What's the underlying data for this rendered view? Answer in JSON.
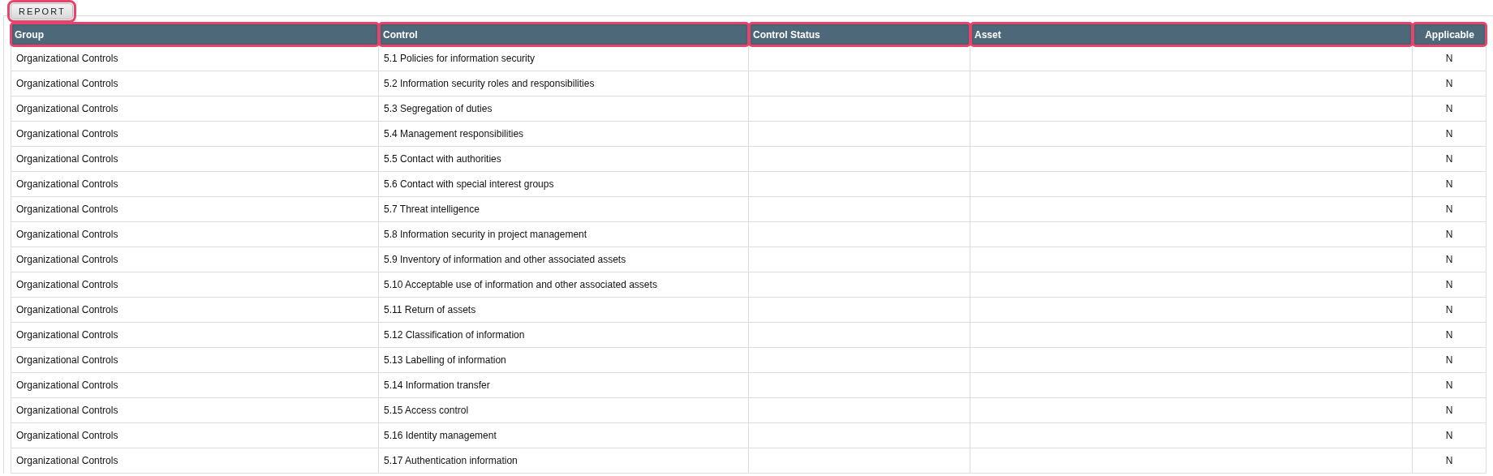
{
  "report_button": {
    "label": "REPORT",
    "highlighted": true
  },
  "table": {
    "columns": [
      {
        "label": "Group",
        "highlighted": true
      },
      {
        "label": "Control",
        "highlighted": true
      },
      {
        "label": "Control Status",
        "highlighted": true
      },
      {
        "label": "Asset",
        "highlighted": true
      },
      {
        "label": "Applicable",
        "highlighted": true
      }
    ],
    "rows": [
      {
        "group": "Organizational Controls",
        "control": "5.1 Policies for information security",
        "applicable": "N"
      },
      {
        "group": "Organizational Controls",
        "control": "5.2 Information security roles and responsibilities",
        "applicable": "N"
      },
      {
        "group": "Organizational Controls",
        "control": "5.3 Segregation of duties",
        "applicable": "N"
      },
      {
        "group": "Organizational Controls",
        "control": "5.4 Management responsibilities",
        "applicable": "N"
      },
      {
        "group": "Organizational Controls",
        "control": "5.5 Contact with authorities",
        "applicable": "N"
      },
      {
        "group": "Organizational Controls",
        "control": "5.6 Contact with special interest groups",
        "applicable": "N"
      },
      {
        "group": "Organizational Controls",
        "control": "5.7 Threat intelligence",
        "applicable": "N"
      },
      {
        "group": "Organizational Controls",
        "control": "5.8 Information security in project management",
        "applicable": "N"
      },
      {
        "group": "Organizational Controls",
        "control": "5.9 Inventory of information and other associated assets",
        "applicable": "N"
      },
      {
        "group": "Organizational Controls",
        "control": "5.10 Acceptable use of information and other associated assets",
        "applicable": "N"
      },
      {
        "group": "Organizational Controls",
        "control": "5.11 Return of assets",
        "applicable": "N"
      },
      {
        "group": "Organizational Controls",
        "control": "5.12 Classification of information",
        "applicable": "N"
      },
      {
        "group": "Organizational Controls",
        "control": "5.13 Labelling of information",
        "applicable": "N"
      },
      {
        "group": "Organizational Controls",
        "control": "5.14 Information transfer",
        "applicable": "N"
      },
      {
        "group": "Organizational Controls",
        "control": "5.15 Access control",
        "applicable": "N"
      },
      {
        "group": "Organizational Controls",
        "control": "5.16 Identity management",
        "applicable": "N"
      },
      {
        "group": "Organizational Controls",
        "control": "5.17 Authentication information",
        "applicable": "N"
      }
    ]
  }
}
